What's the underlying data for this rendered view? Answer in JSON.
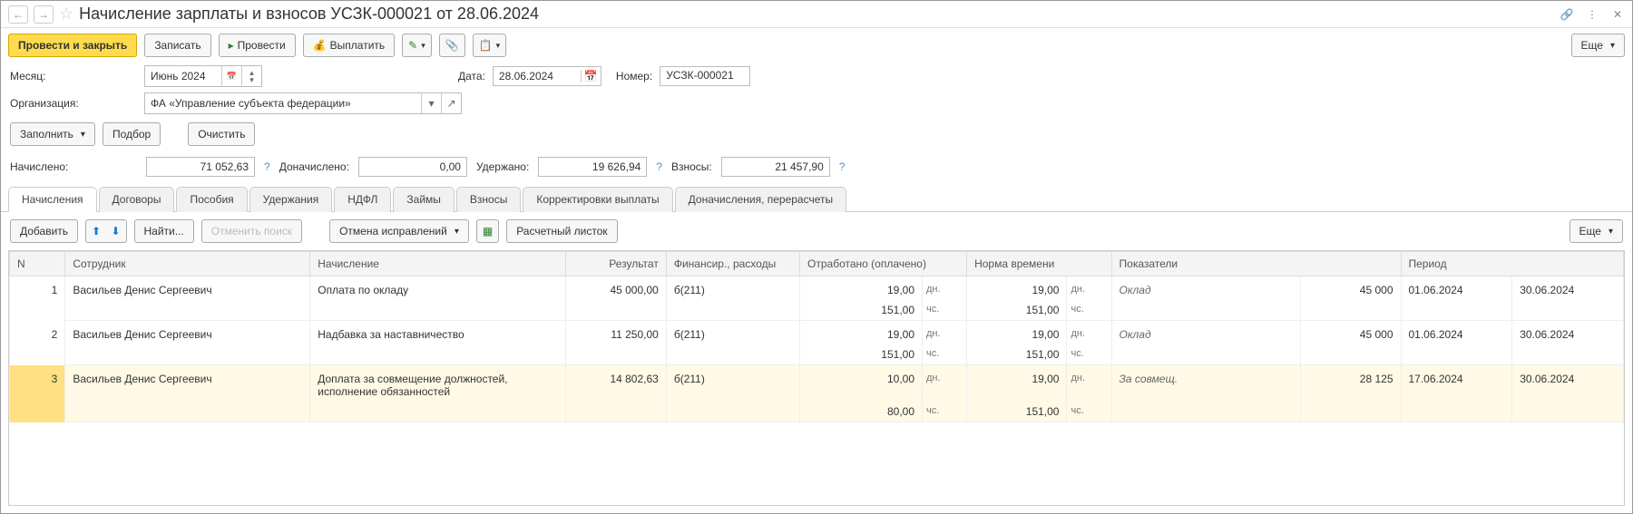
{
  "header": {
    "title": "Начисление зарплаты и взносов УСЗК-000021 от 28.06.2024"
  },
  "toolbar": {
    "submit_close": "Провести и закрыть",
    "save": "Записать",
    "post": "Провести",
    "pay": "Выплатить",
    "more": "Еще"
  },
  "form": {
    "month_label": "Месяц:",
    "month_value": "Июнь 2024",
    "date_label": "Дата:",
    "date_value": "28.06.2024",
    "number_label": "Номер:",
    "number_value": "УСЗК-000021",
    "org_label": "Организация:",
    "org_value": "ФА «Управление субъекта федерации»"
  },
  "row_buttons": {
    "fill": "Заполнить",
    "select": "Подбор",
    "clear": "Очистить"
  },
  "summary": {
    "accrued_label": "Начислено:",
    "accrued_value": "71 052,63",
    "additional_label": "Доначислено:",
    "additional_value": "0,00",
    "withheld_label": "Удержано:",
    "withheld_value": "19 626,94",
    "contrib_label": "Взносы:",
    "contrib_value": "21 457,90"
  },
  "tabs": {
    "t1": "Начисления",
    "t2": "Договоры",
    "t3": "Пособия",
    "t4": "Удержания",
    "t5": "НДФЛ",
    "t6": "Займы",
    "t7": "Взносы",
    "t8": "Корректировки выплаты",
    "t9": "Доначисления, перерасчеты"
  },
  "tab_toolbar": {
    "add": "Добавить",
    "find": "Найти...",
    "cancel_find": "Отменить поиск",
    "undo_fix": "Отмена исправлений",
    "payslip": "Расчетный листок",
    "more": "Еще"
  },
  "columns": {
    "n": "N",
    "emp": "Сотрудник",
    "accr": "Начисление",
    "result": "Результат",
    "fin": "Финансир., расходы",
    "worked": "Отработано (оплачено)",
    "norm": "Норма времени",
    "ind": "Показатели",
    "period": "Период"
  },
  "units": {
    "days": "дн.",
    "hours": "чс."
  },
  "rows": [
    {
      "n": "1",
      "emp": "Васильев Денис Сергеевич",
      "accr": "Оплата по окладу",
      "result": "45 000,00",
      "fin": "б(211)",
      "worked_d": "19,00",
      "worked_h": "151,00",
      "norm_d": "19,00",
      "norm_h": "151,00",
      "ind_name": "Оклад",
      "ind_val": "45 000",
      "period_from": "01.06.2024",
      "period_to": "30.06.2024"
    },
    {
      "n": "2",
      "emp": "Васильев Денис Сергеевич",
      "accr": "Надбавка за наставничество",
      "result": "11 250,00",
      "fin": "б(211)",
      "worked_d": "19,00",
      "worked_h": "151,00",
      "norm_d": "19,00",
      "norm_h": "151,00",
      "ind_name": "Оклад",
      "ind_val": "45 000",
      "period_from": "01.06.2024",
      "period_to": "30.06.2024"
    },
    {
      "n": "3",
      "emp": "Васильев Денис Сергеевич",
      "accr": "Доплата за совмещение должностей, исполнение обязанностей",
      "result": "14 802,63",
      "fin": "б(211)",
      "worked_d": "10,00",
      "worked_h": "80,00",
      "norm_d": "19,00",
      "norm_h": "151,00",
      "ind_name": "За совмещ.",
      "ind_val": "28 125",
      "period_from": "17.06.2024",
      "period_to": "30.06.2024"
    }
  ]
}
